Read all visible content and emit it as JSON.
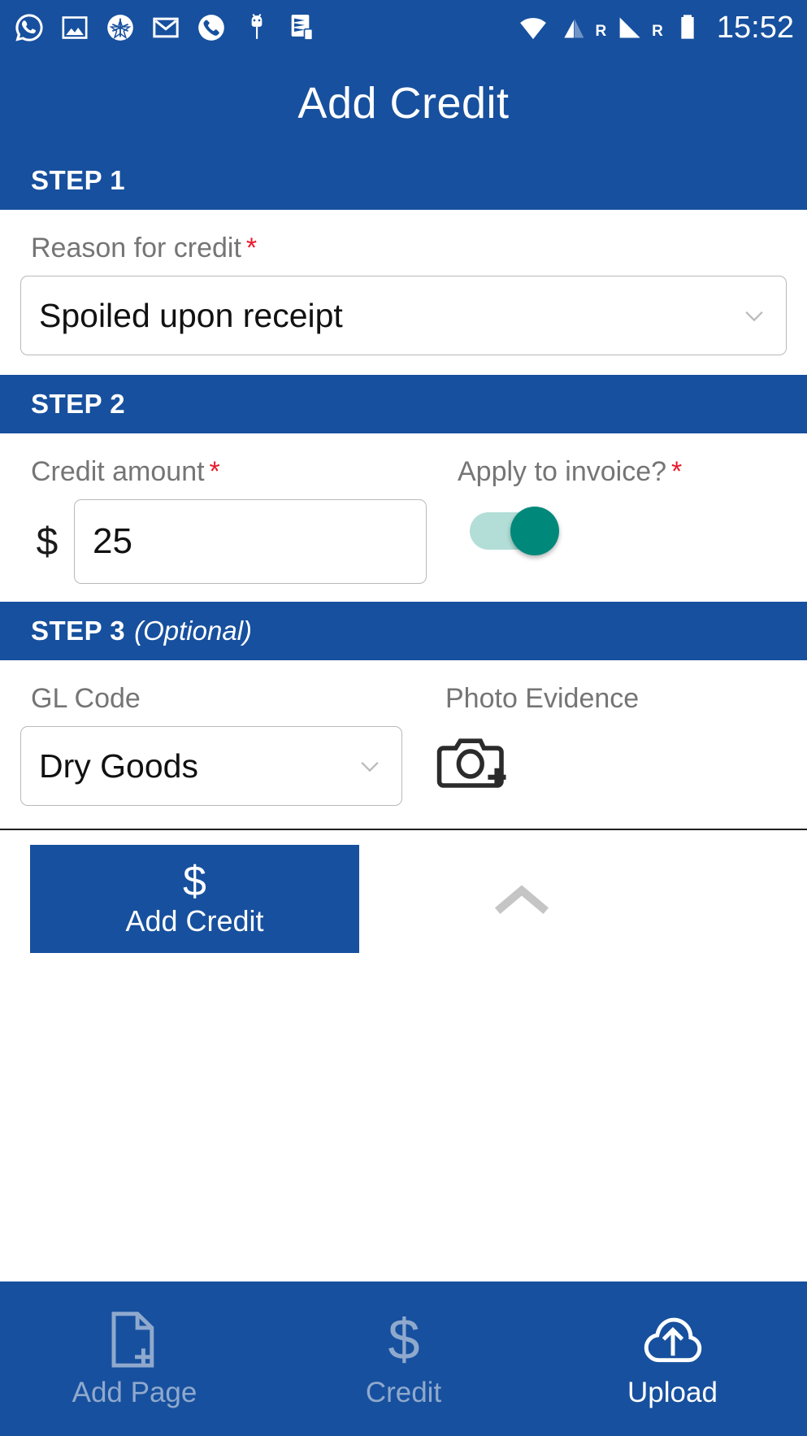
{
  "status_bar": {
    "time": "15:52",
    "left_icons": [
      {
        "name": "whatsapp-icon"
      },
      {
        "name": "gallery-image-icon"
      },
      {
        "name": "star-circle-icon"
      },
      {
        "name": "gmail-icon"
      },
      {
        "name": "phone-call-icon"
      },
      {
        "name": "usb-android-icon"
      },
      {
        "name": "checklist-document-icon"
      }
    ],
    "right_icons": [
      {
        "name": "wifi-icon"
      },
      {
        "name": "signal-1-icon",
        "roaming_label": "R"
      },
      {
        "name": "signal-2-icon",
        "roaming_label": "R"
      },
      {
        "name": "battery-icon"
      }
    ]
  },
  "header": {
    "title": "Add Credit"
  },
  "colors": {
    "brand_blue": "#17509e",
    "toggle_on": "#00897b",
    "toggle_track": "#b2ded7",
    "required_red": "#e8192c",
    "label_gray": "#757575",
    "nav_inactive": "#8fa9cd"
  },
  "step1": {
    "header": "STEP 1",
    "optional_suffix": "",
    "reason_label": "Reason for credit",
    "required_mark": "*",
    "reason_value": "Spoiled upon receipt",
    "chevron_icon": "chevron-down-icon"
  },
  "step2": {
    "header": "STEP 2",
    "amount_label": "Credit amount",
    "amount_required_mark": "*",
    "currency_symbol": "$",
    "amount_value": "25",
    "apply_label": "Apply to invoice?",
    "apply_required_mark": "*",
    "apply_toggle_state": "on"
  },
  "step3": {
    "header": "STEP 3",
    "optional_suffix": "(Optional)",
    "gl_label": "GL Code",
    "gl_value": "Dry Goods",
    "photo_label": "Photo Evidence",
    "camera_icon": "camera-add-icon",
    "chevron_icon": "chevron-down-icon"
  },
  "action_bar": {
    "add_credit_icon": "dollar-icon",
    "add_credit_label": "Add Credit",
    "collapse_icon": "chevron-up-icon"
  },
  "bottom_nav": [
    {
      "label": "Add Page",
      "icon": "page-add-icon",
      "state": "inactive"
    },
    {
      "label": "Credit",
      "icon": "dollar-icon",
      "state": "inactive"
    },
    {
      "label": "Upload",
      "icon": "cloud-upload-icon",
      "state": "active"
    }
  ]
}
